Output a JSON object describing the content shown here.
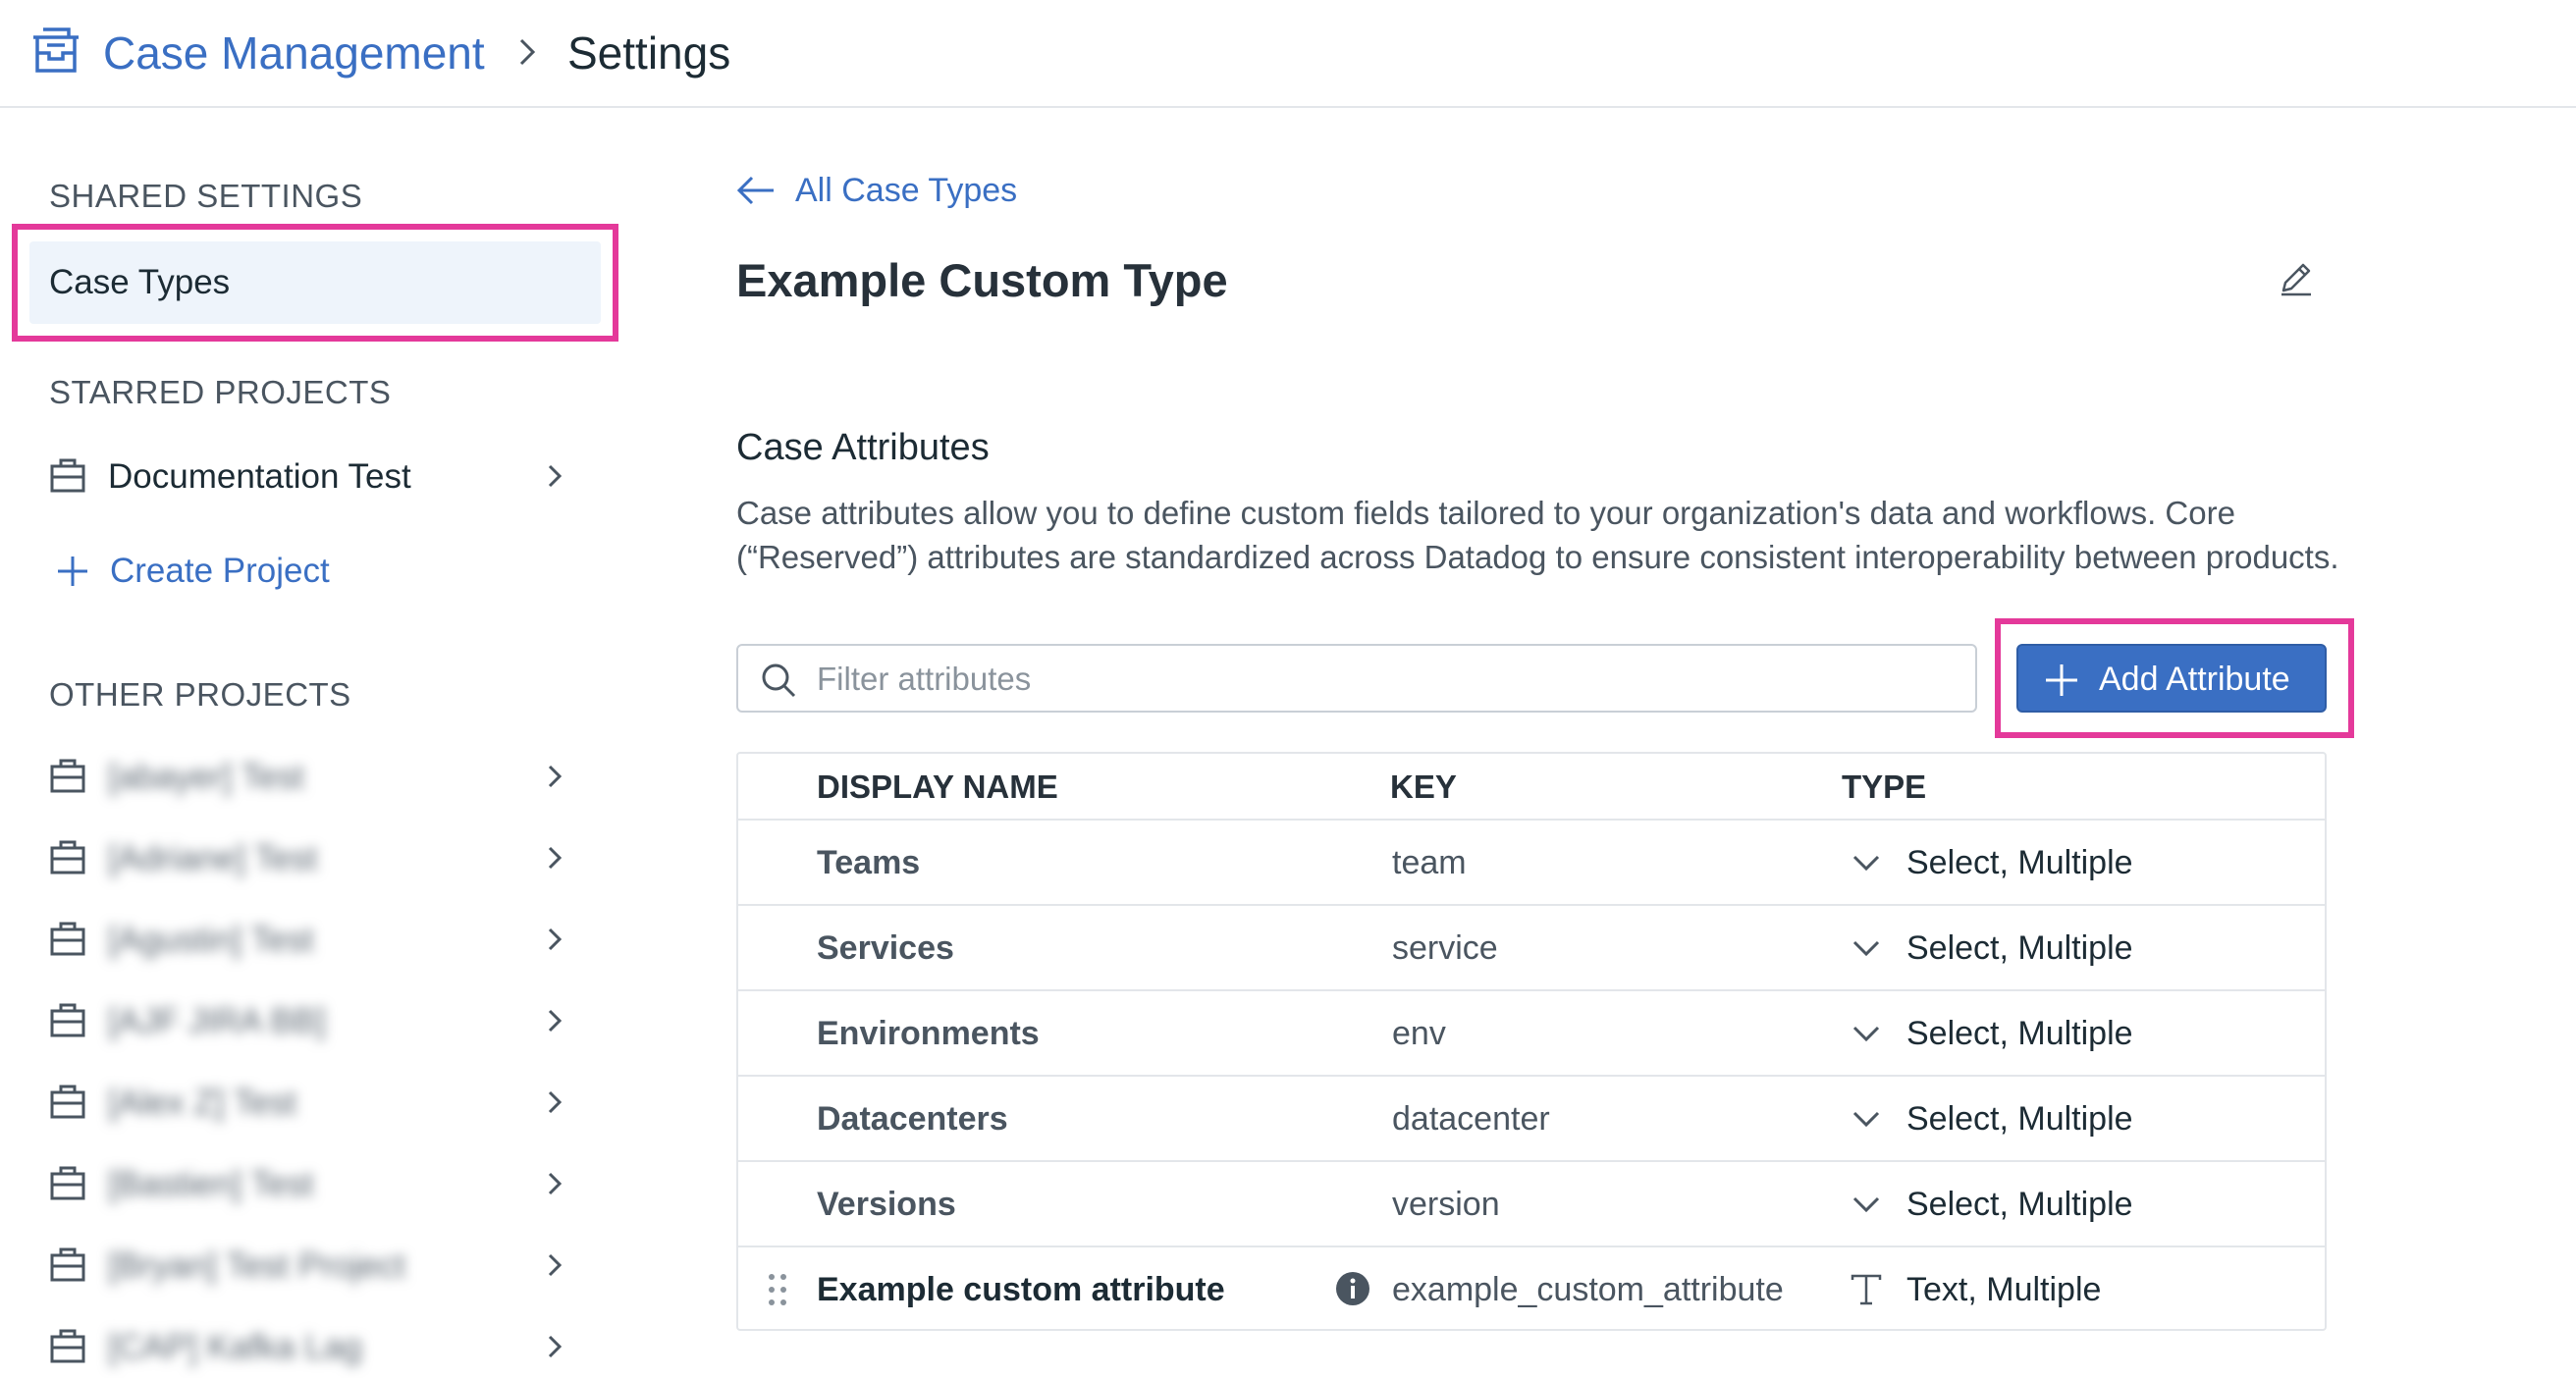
{
  "header": {
    "app_title": "Case Management",
    "page_title": "Settings",
    "icons": {
      "app": "case-management-icon",
      "separator": "chevron-right-icon"
    }
  },
  "sidebar": {
    "shared_settings_heading": "SHARED SETTINGS",
    "case_types_label": "Case Types",
    "starred_heading": "STARRED PROJECTS",
    "starred_projects": [
      {
        "label": "Documentation Test"
      }
    ],
    "create_project_label": "Create Project",
    "other_heading": "OTHER PROJECTS",
    "other_projects": [
      {
        "label": "[abayer] Test"
      },
      {
        "label": "[Adriane] Test"
      },
      {
        "label": "[Agustin] Test"
      },
      {
        "label": "[AJF JIRA BB]"
      },
      {
        "label": "[Alex Z] Test"
      },
      {
        "label": "[Bastien] Test"
      },
      {
        "label": "[Bryan] Test Project"
      },
      {
        "label": "[CAP] Kafka Lag"
      }
    ]
  },
  "main": {
    "back_label": "All Case Types",
    "type_title": "Example Custom Type",
    "attributes_heading": "Case Attributes",
    "attributes_description": "Case attributes allow you to define custom fields tailored to your organization's data and workflows. Core (“Reserved”) attributes are standardized across Datadog to ensure consistent interoperability between products.",
    "filter_placeholder": "Filter attributes",
    "add_button_label": "Add Attribute",
    "highlight_color": "#e4399a",
    "accent_color": "#3a6fc3"
  },
  "table": {
    "headers": {
      "name": "DISPLAY NAME",
      "key": "KEY",
      "type": "TYPE"
    },
    "rows": [
      {
        "name": "Teams",
        "key": "team",
        "type": "Select, Multiple",
        "type_icon": "chevron-down-icon"
      },
      {
        "name": "Services",
        "key": "service",
        "type": "Select, Multiple",
        "type_icon": "chevron-down-icon"
      },
      {
        "name": "Environments",
        "key": "env",
        "type": "Select, Multiple",
        "type_icon": "chevron-down-icon"
      },
      {
        "name": "Datacenters",
        "key": "datacenter",
        "type": "Select, Multiple",
        "type_icon": "chevron-down-icon"
      },
      {
        "name": "Versions",
        "key": "version",
        "type": "Select, Multiple",
        "type_icon": "chevron-down-icon"
      },
      {
        "name": "Example custom attribute",
        "key": "example_custom_attribute",
        "type": "Text, Multiple",
        "type_icon": "text-type-icon"
      }
    ]
  }
}
